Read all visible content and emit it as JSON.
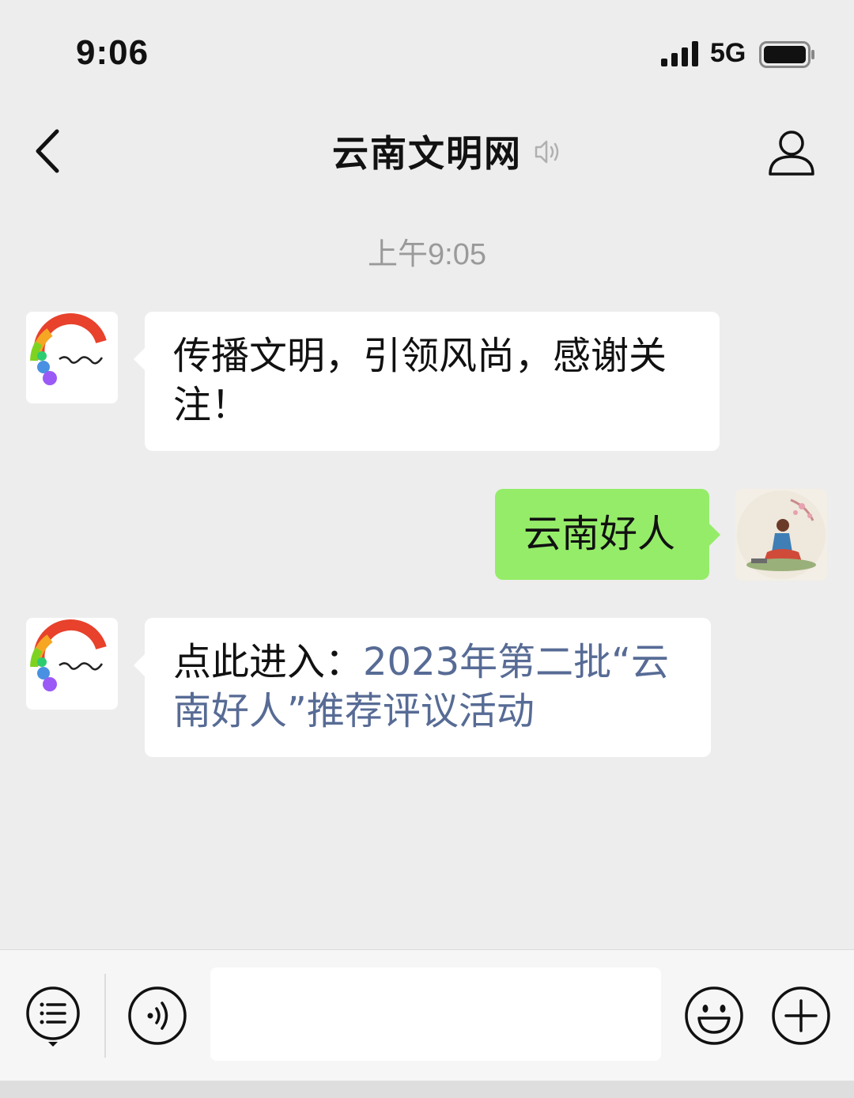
{
  "status_bar": {
    "time": "9:06",
    "network": "5G"
  },
  "header": {
    "title": "云南文明网"
  },
  "chat": {
    "timestamp": "上午9:05",
    "messages": [
      {
        "sender": "account",
        "text": "传播文明，引领风尚，感谢关注！"
      },
      {
        "sender": "me",
        "text": "云南好人"
      },
      {
        "sender": "account",
        "prefix": "点此进入：",
        "link": "2023年第二批“云南好人”推荐评议活动"
      }
    ]
  },
  "input_bar": {
    "message_value": ""
  },
  "colors": {
    "background": "#ededed",
    "bubble_out": "#95ec69",
    "bubble_in": "#ffffff",
    "link": "#576b95"
  }
}
